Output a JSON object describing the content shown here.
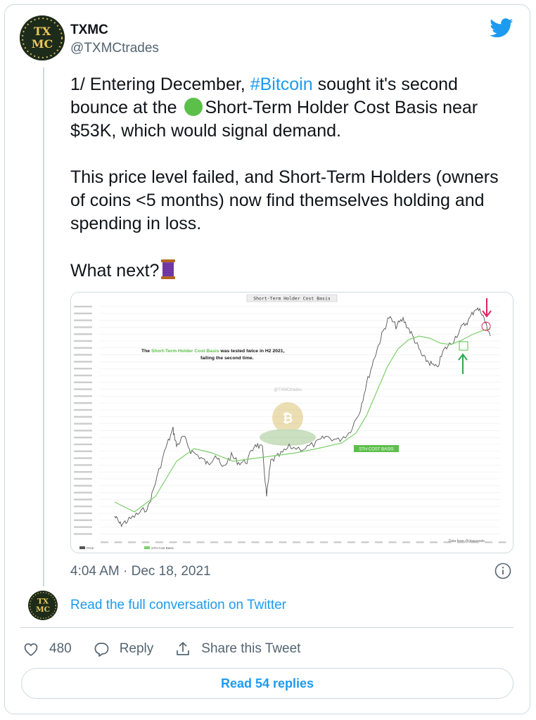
{
  "tweet": {
    "author": {
      "name": "TXMC",
      "handle": "@TXMCtrades",
      "avatar_text": "TXMC"
    },
    "text": {
      "p1_start": "1/ Entering December, ",
      "hashtag": "#Bitcoin",
      "p1_mid": " sought it's second bounce at the ",
      "p1_end": "Short-Term Holder Cost Basis near $53K, which would signal demand.",
      "p2": "This price level failed, and Short-Term Holders (owners of coins <5 months) now find themselves holding and spending in loss.",
      "p3": "What next?"
    },
    "media": {
      "chart_title": "Short-Term Holder Cost Basis",
      "annotation_prefix": "The ",
      "annotation_highlight": "Short-Term Holder Cost Basis",
      "annotation_suffix": " was tested twice in H2 2021,",
      "annotation_line2": "failing the second time.",
      "watermark_handle": "@TXMCtrades",
      "sth_label": "STH COST BASIS",
      "data_source": "Data from @glassnode",
      "legend": [
        "Price",
        "STH Cost Basis"
      ]
    },
    "timestamp": "4:04 AM · Dec 18, 2021"
  },
  "read_conversation": "Read the full conversation on Twitter",
  "actions": {
    "likes": "480",
    "reply": "Reply",
    "share": "Share this Tweet"
  },
  "read_replies": "Read 54 replies",
  "colors": {
    "accent": "#1d9bf0",
    "sth_green": "#5cbf4a",
    "price_line": "#555555",
    "arrow_red": "#e0245e",
    "arrow_green": "#2fa84f"
  },
  "icons": [
    "twitter-bird-icon",
    "green-circle-emoji",
    "thread-spool-emoji",
    "info-icon",
    "heart-icon",
    "reply-bubble-icon",
    "share-icon"
  ]
}
